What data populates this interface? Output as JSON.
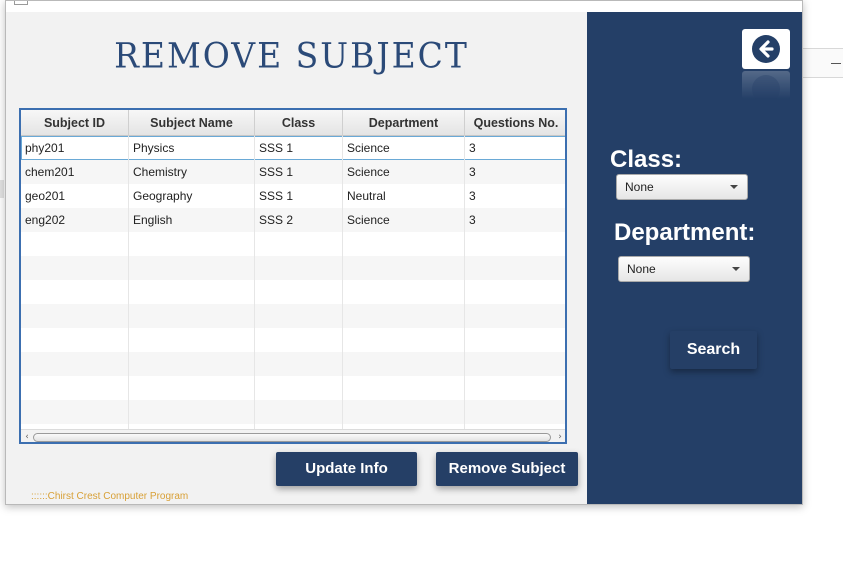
{
  "page_title": "REMOVE SUBJECT",
  "table": {
    "columns": [
      "Subject ID",
      "Subject Name",
      "Class",
      "Department",
      "Questions No."
    ],
    "rows": [
      [
        "phy201",
        "Physics",
        "SSS 1",
        "Science",
        "3"
      ],
      [
        "chem201",
        "Chemistry",
        "SSS 1",
        "Science",
        "3"
      ],
      [
        "geo201",
        "Geography",
        "SSS 1",
        "Neutral",
        "3"
      ],
      [
        "eng202",
        "English",
        "SSS 2",
        "Science",
        "3"
      ]
    ],
    "selected_row": 0
  },
  "buttons": {
    "update": "Update Info",
    "remove": "Remove Subject",
    "search": "Search"
  },
  "footer": "::::::Chirst Crest Computer Program",
  "side": {
    "class_label": "Class:",
    "class_value": "None",
    "department_label": "Department:",
    "department_value": "None"
  },
  "icons": {
    "back": "back-arrow-icon",
    "combo_caret": "chevron-down-icon"
  },
  "colors": {
    "panel": "#243f67",
    "button": "#253f66",
    "title": "#2b4a78",
    "footer_text": "#d8a036",
    "table_border": "#3c6fb0"
  }
}
